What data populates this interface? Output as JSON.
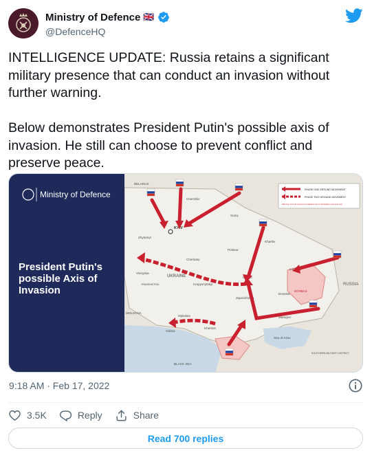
{
  "author": {
    "name": "Ministry of Defence",
    "flag": "🇬🇧",
    "handle": "@DefenceHQ"
  },
  "tweet": {
    "text": "INTELLIGENCE UPDATE: Russia retains a significant military presence that can conduct an invasion without further warning.\n\nBelow demonstrates President Putin's possible axis of invasion. He still can choose to prevent conflict and preserve peace.",
    "timestamp": "9:18 AM · Feb 17, 2022"
  },
  "media": {
    "brand": "Ministry of Defence",
    "title_lines": [
      "President Putin's",
      "possible Axis of",
      "Invasion"
    ],
    "legend": {
      "phase_one": "PHASE ONE GROUND MOVEMENT",
      "phase_two": "PHASE TWO GROUND MOVEMENT",
      "warning": "Warning: Ground movement indicators are for illustrative purposes only"
    },
    "map_labels": {
      "belarus": "BELARUS",
      "ukraine": "UKRAINE",
      "russia": "RUSSIA",
      "kyiv": "KYIV",
      "moldova": "MOLDOVA",
      "black_sea": "BLACK SEA",
      "sea_of_azov": "Sea of Azov",
      "donbas": "DONBAS",
      "southern_district": "SOUTHERN MILITARY DISTRICT",
      "transnistria": "TRANSNISTRIA",
      "chernihiv": "Chernihiv",
      "sumy": "Sumy",
      "kharkiv": "Kharkiv",
      "poltava": "Poltava",
      "zhytomyr": "Zhytomyr",
      "vinnytsia": "Vinnytsia",
      "cherkasy": "Cherkasy",
      "kropyvnytskyi": "Kropyvnytskyi",
      "dnipro": "Dnipro",
      "zaporizhzhia": "Zaporizhzhia",
      "mykolaiv": "Mykolaiv",
      "kherson": "Kherson",
      "odesa": "Odesa",
      "luhansk": "Luhansk",
      "donetsk": "Donetsk",
      "mariupol": "Mariupol"
    }
  },
  "actions": {
    "likes": "3.5K",
    "reply_label": "Reply",
    "share_label": "Share"
  },
  "read_replies_label": "Read 700 replies",
  "colors": {
    "accent": "#1d9bf0",
    "navy_panel": "#1f2a5a",
    "arrow_red": "#c8202f"
  }
}
